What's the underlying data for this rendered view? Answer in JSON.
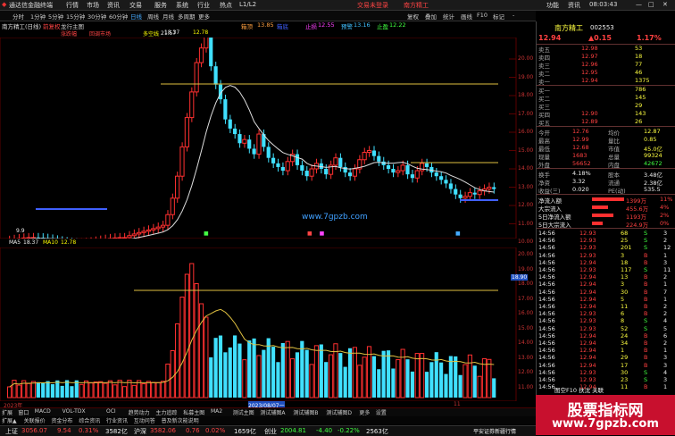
{
  "menu": {
    "app_title": "通达信金融终端",
    "items": [
      "行情",
      "市场",
      "资讯",
      "交易",
      "服务",
      "系统",
      "行业",
      "热点",
      "L1/L2"
    ],
    "center_left": "交易未登录",
    "center_right": "南方精工",
    "right_items": [
      "功能",
      "资讯",
      "08:03:43"
    ]
  },
  "toolbar": {
    "periods": [
      "分时",
      "1分钟",
      "5分钟",
      "15分钟",
      "30分钟",
      "60分钟",
      "日线",
      "周线",
      "月线",
      "多周期",
      "更多"
    ],
    "active": "日线",
    "right_tools": [
      "复权",
      "叠加",
      "统计",
      "画线",
      "F10",
      "标记",
      "-"
    ]
  },
  "info": {
    "stock": "南方精工(日线)",
    "fuquan": "前复权",
    "zhangfu": "涨跌幅",
    "longhu": "龙行主图",
    "huiche": "回调市场",
    "tag1": "多空线",
    "ma_a": "18.37",
    "ma_b": "12.78",
    "ind_a": "箱顶",
    "ind_a_v": "13.85",
    "ind_b": "箱底",
    "ind_c": "止损",
    "ind_c_v": "12.55",
    "ind_d": "预警",
    "ind_d_v": "13.16",
    "ind_e": "止盈",
    "ind_e_v": "12.22"
  },
  "price_axis": [
    "20.00",
    "19.00",
    "18.00",
    "17.00",
    "16.00",
    "15.00",
    "14.00",
    "13.00",
    "12.00",
    "11.00",
    "10.00"
  ],
  "price_peak": "21.57",
  "price_low": "9.9",
  "volume_info": {
    "label": "MA5",
    "ma5": "18.37",
    "ma10_label": "MA10",
    "ma10": "12.78"
  },
  "volume_axis": [
    "20.00",
    "19.00",
    "18.00",
    "17.00",
    "16.00",
    "15.00",
    "14.00",
    "13.00",
    "12.00",
    "11.00"
  ],
  "volume_tag": "18.90",
  "date_axis": [
    "2023年",
    "2023/08/07一",
    "11"
  ],
  "watermark": "www.7gpzb.com",
  "bottom_tabs1": [
    "扩展",
    "窗口",
    "MACD",
    "VOL-TDX",
    "OCI",
    "趋势动力",
    "主力追踪",
    "私募主图",
    "MA2",
    "测试主图",
    "测试辅图A",
    "测试辅图B",
    "测试辅图D",
    "更多",
    "设置"
  ],
  "bottom_tabs2": [
    "扩展▲",
    "关联报价",
    "资金分布",
    "综合资讯",
    "行业资讯",
    "互动问答",
    "普及新次能说明"
  ],
  "right_panel": {
    "name": "南方精工",
    "code": "002553",
    "price": "12.94",
    "change": "▲0.15",
    "pct": "1.17%",
    "asks": [
      {
        "label": "卖五",
        "price": "12.98",
        "vol": "53"
      },
      {
        "label": "卖四",
        "price": "12.97",
        "vol": "18"
      },
      {
        "label": "卖三",
        "price": "12.96",
        "vol": "77"
      },
      {
        "label": "卖二",
        "price": "12.95",
        "vol": "46"
      },
      {
        "label": "卖一",
        "price": "12.94",
        "vol": "1375"
      }
    ],
    "bids": [
      {
        "label": "买一",
        "price": "",
        "vol": "786"
      },
      {
        "label": "买二",
        "price": "",
        "vol": "145"
      },
      {
        "label": "买三",
        "price": "",
        "vol": "29"
      },
      {
        "label": "买四",
        "price": "12.90",
        "vol": "143"
      },
      {
        "label": "买五",
        "price": "12.89",
        "vol": "26"
      }
    ],
    "stats": [
      {
        "l1": "今开",
        "v1": "12.76",
        "l2": "均价",
        "v2": "12.87"
      },
      {
        "l1": "最高",
        "v1": "12.99",
        "l2": "量比",
        "v2": "0.85"
      },
      {
        "l1": "最低",
        "v1": "12.68",
        "l2": "市值",
        "v2": "45.0亿"
      },
      {
        "l1": "现量",
        "v1": "1683",
        "l2": "总量",
        "v2": "99324"
      },
      {
        "l1": "外盘",
        "v1": "56652",
        "l2": "内盘",
        "v2": "42672"
      }
    ],
    "stats2": [
      {
        "l1": "换手",
        "v1": "4.18%",
        "l2": "股本",
        "v2": "3.48亿"
      },
      {
        "l1": "净资",
        "v1": "3.32",
        "l2": "流通",
        "v2": "2.38亿"
      },
      {
        "l1": "收益(三)",
        "v1": "0.020",
        "l2": "PE(动)",
        "v2": "535.5"
      }
    ],
    "flows": [
      {
        "label": "净流入额",
        "val": "1399万",
        "pct": "11%"
      },
      {
        "label": "大宗流入",
        "val": "455.6万",
        "pct": "4%"
      },
      {
        "label": "5日净流入额",
        "val": "1193万",
        "pct": "2%"
      },
      {
        "label": "5日大宗流入",
        "val": "224.9万",
        "pct": "0%"
      }
    ],
    "ticks": [
      {
        "t": "14:56",
        "p": "12.93",
        "v": "68",
        "d": "S",
        "n": "3"
      },
      {
        "t": "14:56",
        "p": "12.93",
        "v": "25",
        "d": "S",
        "n": "2"
      },
      {
        "t": "14:56",
        "p": "12.93",
        "v": "201",
        "d": "S",
        "n": "12"
      },
      {
        "t": "14:56",
        "p": "12.93",
        "v": "3",
        "d": "B",
        "n": "1"
      },
      {
        "t": "14:56",
        "p": "12.94",
        "v": "18",
        "d": "B",
        "n": "3"
      },
      {
        "t": "14:56",
        "p": "12.93",
        "v": "117",
        "d": "S",
        "n": "11"
      },
      {
        "t": "14:56",
        "p": "12.94",
        "v": "13",
        "d": "B",
        "n": "2"
      },
      {
        "t": "14:56",
        "p": "12.94",
        "v": "3",
        "d": "B",
        "n": "1"
      },
      {
        "t": "14:56",
        "p": "12.94",
        "v": "30",
        "d": "B",
        "n": "7"
      },
      {
        "t": "14:56",
        "p": "12.94",
        "v": "5",
        "d": "B",
        "n": "1"
      },
      {
        "t": "14:56",
        "p": "12.94",
        "v": "11",
        "d": "B",
        "n": "2"
      },
      {
        "t": "14:56",
        "p": "12.93",
        "v": "6",
        "d": "B",
        "n": "2"
      },
      {
        "t": "14:56",
        "p": "12.93",
        "v": "8",
        "d": "S",
        "n": "4"
      },
      {
        "t": "14:56",
        "p": "12.93",
        "v": "52",
        "d": "S",
        "n": "5"
      },
      {
        "t": "14:56",
        "p": "12.94",
        "v": "24",
        "d": "B",
        "n": "6"
      },
      {
        "t": "14:56",
        "p": "12.94",
        "v": "34",
        "d": "B",
        "n": "2"
      },
      {
        "t": "14:56",
        "p": "12.94",
        "v": "1",
        "d": "B",
        "n": "1"
      },
      {
        "t": "14:56",
        "p": "12.94",
        "v": "29",
        "d": "B",
        "n": "3"
      },
      {
        "t": "14:56",
        "p": "12.94",
        "v": "17",
        "d": "B",
        "n": "3"
      },
      {
        "t": "14:56",
        "p": "12.93",
        "v": "30",
        "d": "S",
        "n": "4"
      },
      {
        "t": "14:56",
        "p": "12.93",
        "v": "23",
        "d": "S",
        "n": "3"
      },
      {
        "t": "14:56",
        "p": "12.94",
        "v": "11",
        "d": "B",
        "n": "1"
      },
      {
        "t": "14:56",
        "p": "12.93",
        "v": "44",
        "d": "S",
        "n": "3"
      }
    ],
    "bottom_label": "图空F10 扶沈 关联"
  },
  "banner": {
    "title": "股票指标网",
    "url": "www.7gpzb.com"
  },
  "status": {
    "sh_label": "上证",
    "sh_val": "3056.07",
    "sh_chg": "9.54",
    "sh_pct": "0.31%",
    "sh_amt": "3582亿",
    "sz_label": "沪深",
    "sz_val": "3582.06",
    "sz_chg": "0.76",
    "sz_pct": "0.02%",
    "sz_amt": "1659亿",
    "cy_label": "创业",
    "cy_val": "2004.81",
    "cy_chg": "-4.40",
    "cy_pct": "-0.22%",
    "cy_amt": "2563亿",
    "right": "平安证券新疆行情"
  }
}
